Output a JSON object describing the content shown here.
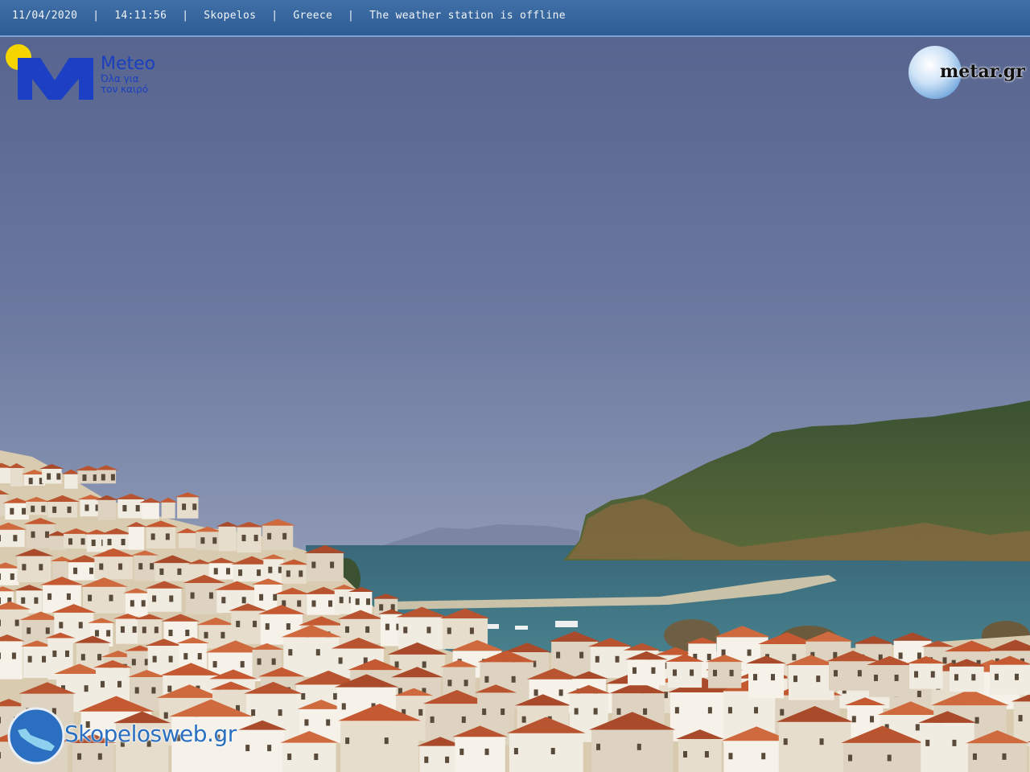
{
  "top_bar": {
    "date": "11/04/2020",
    "time": "14:11:56",
    "location": "Skopelos",
    "country": "Greece",
    "status": "The weather station is offline",
    "separator": "|"
  },
  "logos": {
    "meteo": {
      "name": "Meteo",
      "tagline_1": "Όλα για",
      "tagline_2": "τον καιρό"
    },
    "metar": {
      "text": "metar.gr"
    },
    "skopelosweb": {
      "text": "Skopelosweb.gr"
    }
  },
  "colors": {
    "sky_top": "#56648f",
    "sky_bottom": "#8a95b3",
    "sea": "#3d7787",
    "roof": "#c55a32",
    "hill": "#3f5a35",
    "bar": "#2e5d95"
  }
}
